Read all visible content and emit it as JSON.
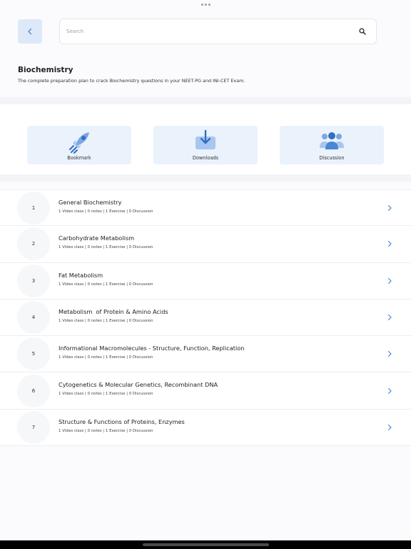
{
  "header": {
    "search_placeholder": "Search",
    "icons": {
      "back": "chevron-left-icon",
      "search": "search-icon"
    }
  },
  "page": {
    "title": "Biochemistry",
    "subtitle": "The complete preparation plan to crack Biochemistry questions in your NEET-PG and INI-CET Exam."
  },
  "quick_actions": [
    {
      "label": "Bookmark",
      "icon": "rocket-icon"
    },
    {
      "label": "Downloads",
      "icon": "download-icon"
    },
    {
      "label": "Discussion",
      "icon": "users-icon"
    }
  ],
  "chapters": [
    {
      "number": "1",
      "title": "General Biochemistry",
      "meta": "1 Video class | 0 notes | 1 Exercise | 0 Discussion"
    },
    {
      "number": "2",
      "title": "Carbohydrate Metabolism",
      "meta": "1 Video class | 0 notes | 1 Exercise | 0 Discussion"
    },
    {
      "number": "3",
      "title": "Fat Metabolism",
      "meta": "1 Video class | 0 notes | 1 Exercise | 0 Discussion"
    },
    {
      "number": "4",
      "title": "Metabolism  of Protein & Amino Acids",
      "meta": "1 Video class | 0 notes | 1 Exercise | 0 Discussion"
    },
    {
      "number": "5",
      "title": "Informational Macromolecules - Structure, Function, Replication",
      "meta": "1 Video class | 0 notes | 1 Exercise | 0 Discussion"
    },
    {
      "number": "6",
      "title": "Cytogenetics & Molecular Genetics, Recombinant DNA",
      "meta": "1 Video class | 0 notes | 1 Exercise | 0 Discussion"
    },
    {
      "number": "7",
      "title": "Structure & Functions of Proteins, Enzymes",
      "meta": "1 Video class | 0 notes | 1 Exercise | 0 Discussion"
    }
  ],
  "colors": {
    "accent": "#4a86d8",
    "card_bg": "#eaf2fc",
    "back_bg": "#dde9f9"
  }
}
